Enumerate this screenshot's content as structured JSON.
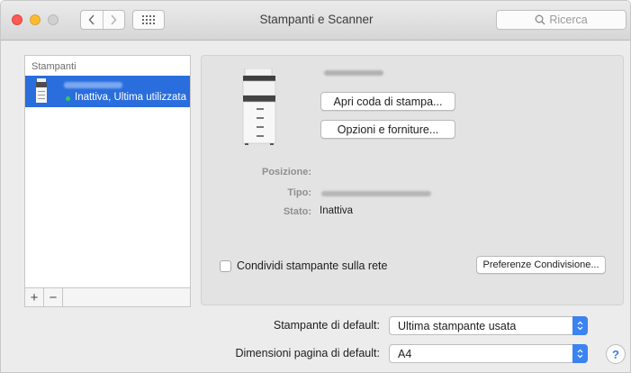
{
  "window": {
    "title": "Stampanti e Scanner",
    "search_placeholder": "Ricerca"
  },
  "sidebar": {
    "header": "Stampanti",
    "printers": [
      {
        "status": "Inattiva, Ultima utilizzata",
        "status_color": "#2ad04d",
        "selected": true
      }
    ],
    "add_label": "+",
    "remove_label": "−"
  },
  "detail": {
    "open_queue_label": "Apri coda di stampa...",
    "options_label": "Opzioni e forniture...",
    "location_label": "Posizione:",
    "type_label": "Tipo:",
    "state_label": "Stato:",
    "state_value": "Inattiva",
    "share_label": "Condividi stampante sulla rete",
    "share_checked": false,
    "sharing_prefs_label": "Preferenze Condivisione..."
  },
  "settings": {
    "default_printer_label": "Stampante di default:",
    "default_printer_value": "Ultima stampante usata",
    "paper_size_label": "Dimensioni pagina di default:",
    "paper_size_value": "A4",
    "help_label": "?"
  },
  "colors": {
    "selection": "#2a6ddd",
    "accent": "#3b83f0"
  },
  "icons": [
    "back-icon",
    "forward-icon",
    "grid-icon",
    "search-icon",
    "printer-icon",
    "chevron-updown-icon",
    "help-icon"
  ]
}
